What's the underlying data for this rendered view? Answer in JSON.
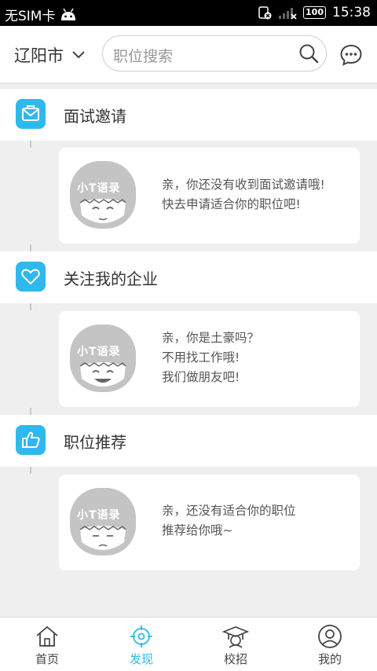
{
  "status_bar": {
    "carrier": "无SIM卡",
    "battery": "100",
    "time": "15:38"
  },
  "header": {
    "city": "辽阳市",
    "search_placeholder": "职位搜索"
  },
  "sections": [
    {
      "title": "面试邀请",
      "badge": "小T语录",
      "lines": [
        "亲，你还没有收到面试邀请哦!",
        "快去申请适合你的职位吧!"
      ]
    },
    {
      "title": "关注我的企业",
      "badge": "小T语录",
      "lines": [
        "亲，你是土豪吗？",
        "不用找工作哦!",
        "我们做朋友吧!"
      ]
    },
    {
      "title": "职位推荐",
      "badge": "小T语录",
      "lines": [
        "亲，还没有适合你的职位",
        "推荐给你哦~"
      ]
    }
  ],
  "tabs": [
    {
      "label": "首页",
      "icon": "home-icon"
    },
    {
      "label": "发现",
      "icon": "discover-icon",
      "active": true
    },
    {
      "label": "校招",
      "icon": "graduation-cap-icon"
    },
    {
      "label": "我的",
      "icon": "profile-icon"
    }
  ],
  "colors": {
    "accent": "#2fb8ee",
    "background": "#efefef"
  }
}
